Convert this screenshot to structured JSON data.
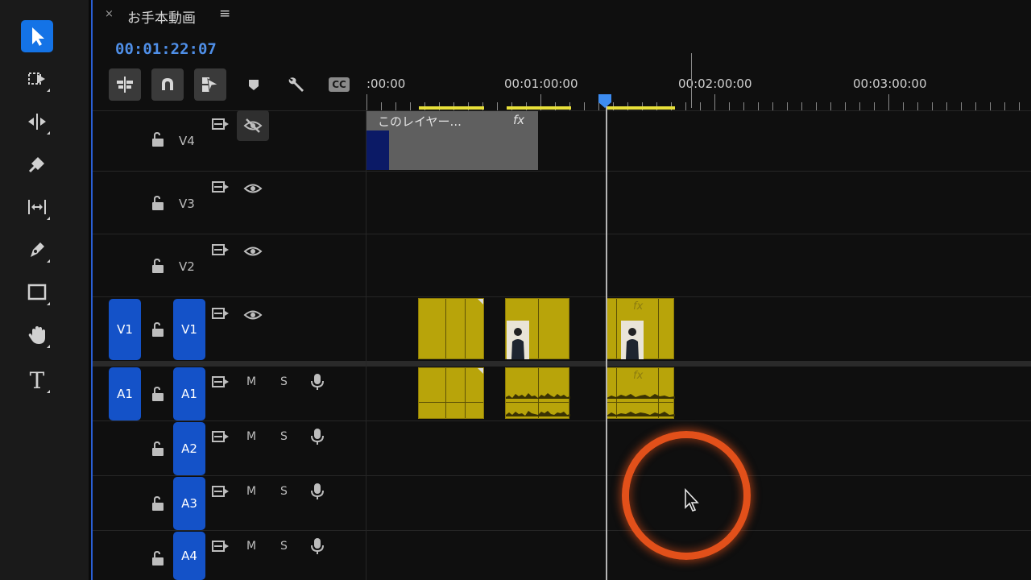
{
  "toolbar": {
    "tools": [
      {
        "name": "selection-tool",
        "icon": "arrow-icon",
        "active": true
      },
      {
        "name": "track-select-tool",
        "icon": "track-select-icon"
      },
      {
        "name": "ripple-edit-tool",
        "icon": "ripple-edit-icon"
      },
      {
        "name": "razor-tool",
        "icon": "razor-icon"
      },
      {
        "name": "slip-tool",
        "icon": "slip-icon"
      },
      {
        "name": "pen-tool",
        "icon": "pen-icon"
      },
      {
        "name": "rectangle-tool",
        "icon": "rectangle-icon"
      },
      {
        "name": "hand-tool",
        "icon": "hand-icon"
      },
      {
        "name": "type-tool",
        "icon": "type-icon",
        "label": "T"
      }
    ]
  },
  "sequence": {
    "close_label": "×",
    "title": "お手本動画",
    "menu_label": "≡",
    "timecode": "00:01:22:07"
  },
  "timeline_tools": {
    "cc_label": "CC",
    "icons": [
      "insert-sequence-icon",
      "snap-magnet-icon",
      "linked-selection-icon",
      "add-marker-icon",
      "settings-wrench-icon",
      "captions-icon"
    ]
  },
  "ruler": {
    "labels": [
      ":00:00",
      "00:01:00:00",
      "00:02:00:00",
      "00:03:00:00"
    ]
  },
  "tracks": {
    "video": [
      {
        "id": "V4",
        "label": "V4",
        "visible": false
      },
      {
        "id": "V3",
        "label": "V3",
        "visible": true
      },
      {
        "id": "V2",
        "label": "V2",
        "visible": true
      },
      {
        "id": "V1",
        "label": "V1",
        "source": "V1",
        "visible": true
      }
    ],
    "audio": [
      {
        "id": "A1",
        "label": "A1",
        "source": "A1",
        "mute": "M",
        "solo": "S"
      },
      {
        "id": "A2",
        "label": "A2",
        "mute": "M",
        "solo": "S"
      },
      {
        "id": "A3",
        "label": "A3",
        "mute": "M",
        "solo": "S"
      },
      {
        "id": "A4",
        "label": "A4",
        "mute": "M",
        "solo": "S"
      }
    ]
  },
  "clips": {
    "title_clip": {
      "name": "このレイヤー...",
      "fx": "fx"
    },
    "fx_label": "fx"
  },
  "colors": {
    "accent": "#1473e6",
    "timecode": "#4f8fe8",
    "clip_video": "#b8a40a",
    "in_out_bar": "#e8e03a",
    "cursor_ring": "#e2501a"
  }
}
